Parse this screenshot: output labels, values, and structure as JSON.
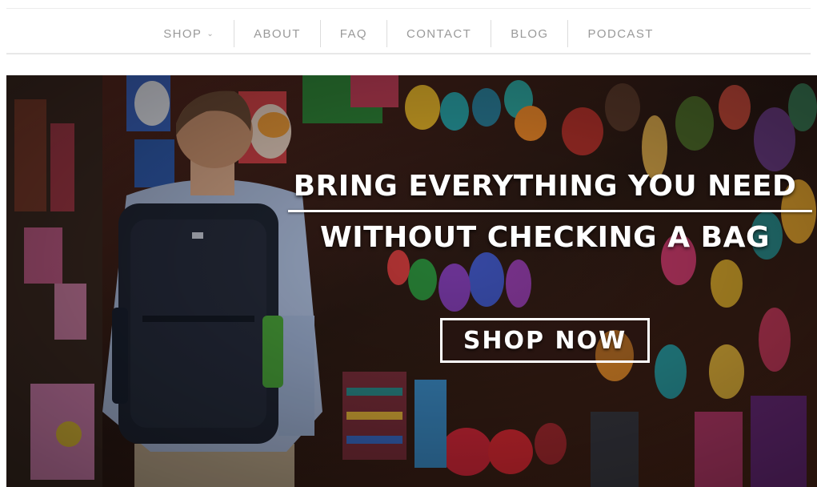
{
  "nav": {
    "items": [
      {
        "label": "SHOP",
        "has_dropdown": true
      },
      {
        "label": "ABOUT"
      },
      {
        "label": "FAQ"
      },
      {
        "label": "CONTACT"
      },
      {
        "label": "BLOG"
      },
      {
        "label": "PODCAST"
      }
    ],
    "dropdown_icon": "chevron-down-icon"
  },
  "hero": {
    "headline_line1": "BRING EVERYTHING YOU NEED",
    "headline_line2": "WITHOUT CHECKING A BAG",
    "cta_label": "SHOP NOW"
  },
  "colors": {
    "nav_text": "#9a9a9a",
    "hero_text": "#ffffff"
  }
}
